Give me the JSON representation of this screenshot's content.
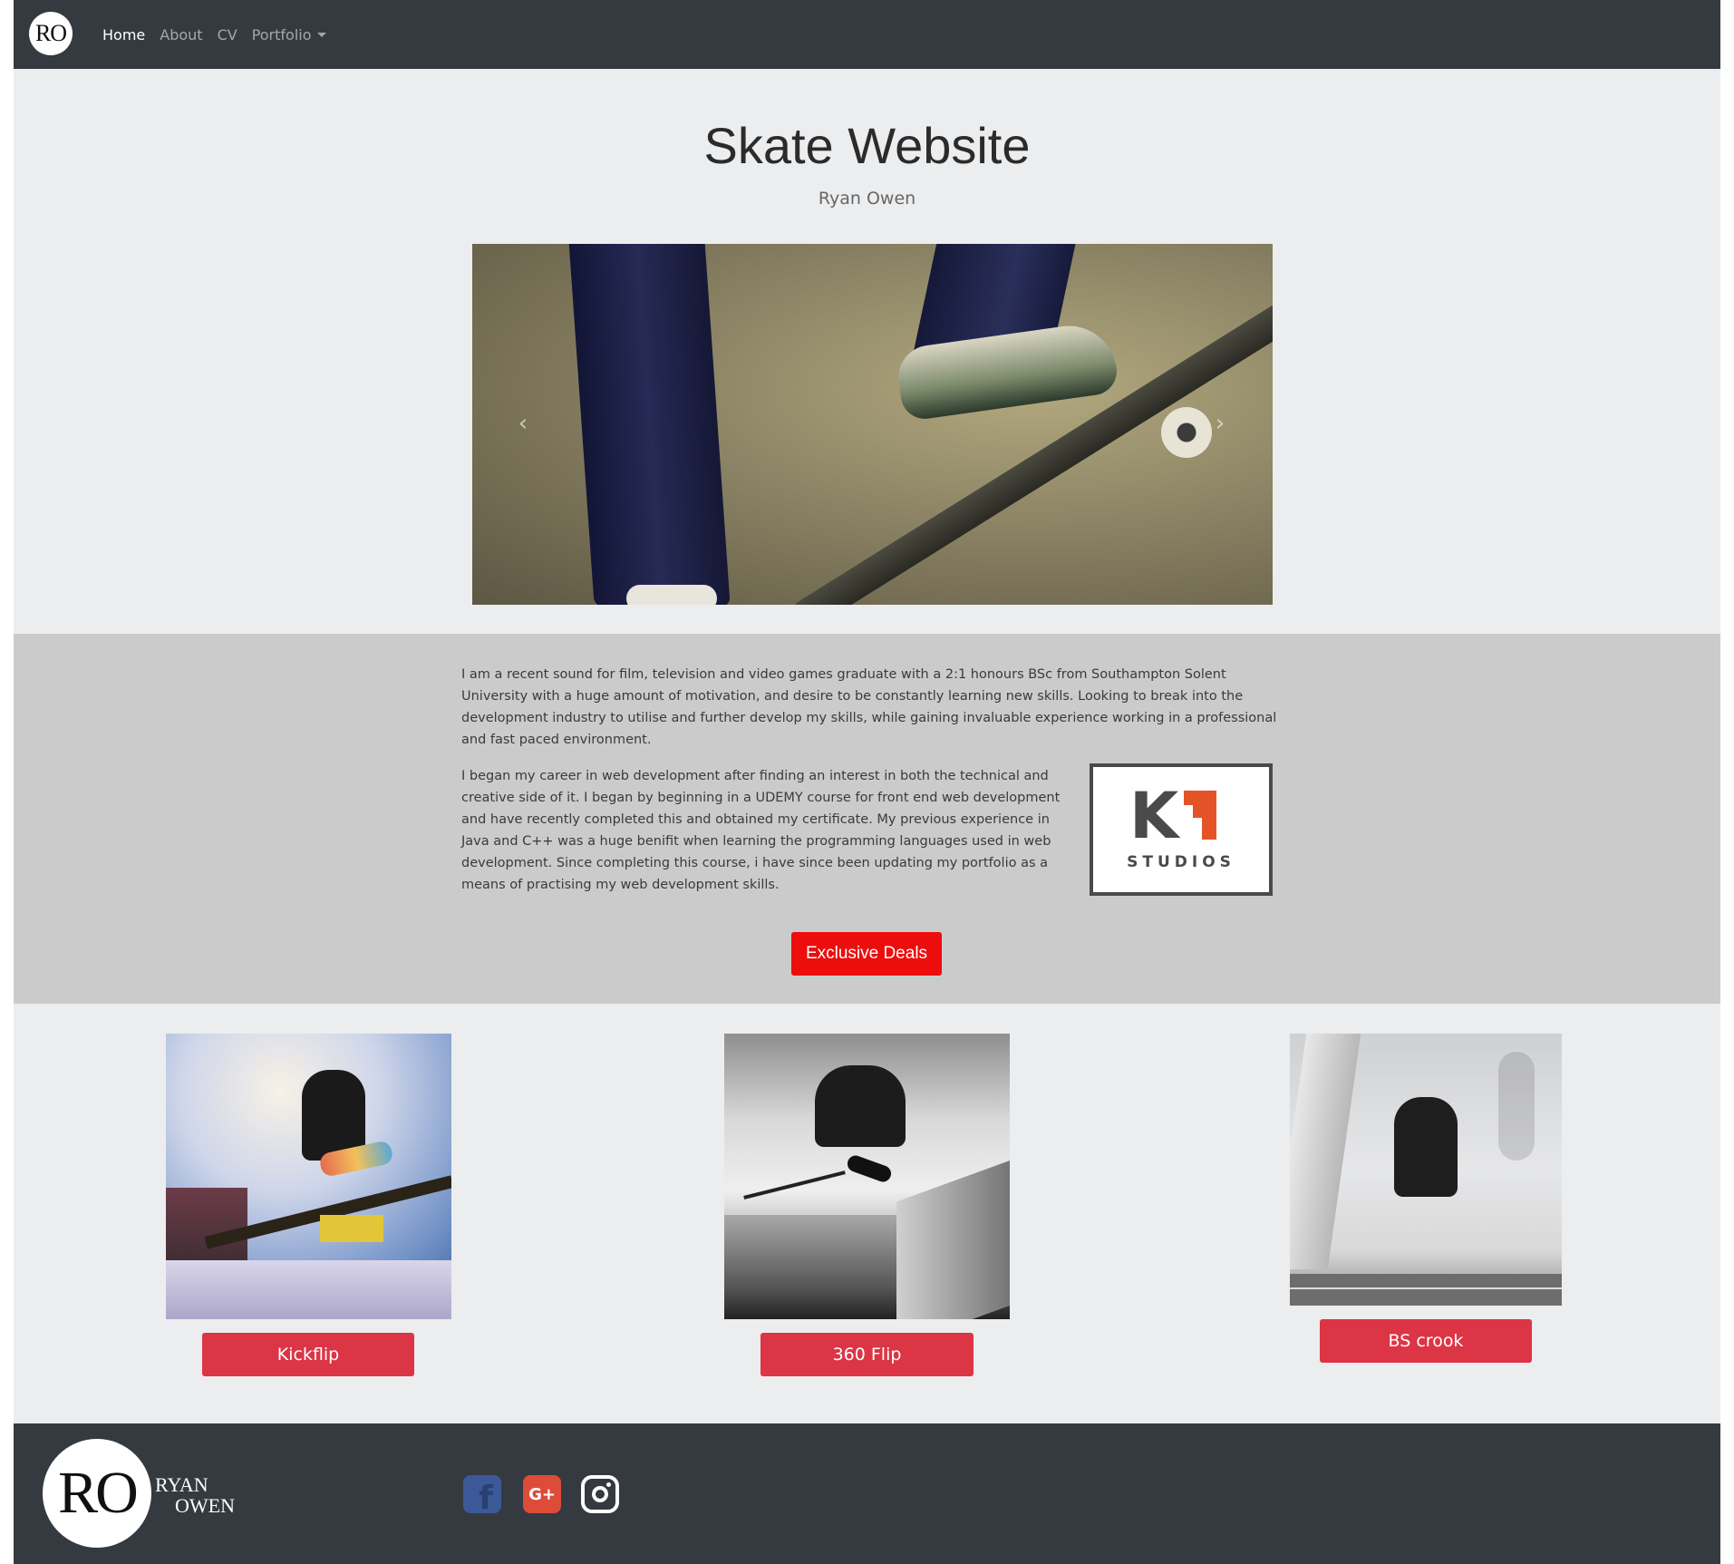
{
  "navbar": {
    "logo_text": "RO",
    "links": [
      {
        "label": "Home",
        "active": true
      },
      {
        "label": "About",
        "active": false
      },
      {
        "label": "CV",
        "active": false
      },
      {
        "label": "Portfolio",
        "active": false,
        "dropdown": true
      }
    ]
  },
  "hero": {
    "title": "Skate Website",
    "subtitle": "Ryan Owen",
    "carousel": {
      "prev_icon": "chevron-left-icon",
      "next_icon": "chevron-right-icon"
    }
  },
  "about": {
    "paragraph1": "I am a recent sound for film, television and video games graduate with a 2:1 honours BSc from Southampton Solent University with a huge amount of motivation, and desire to be constantly learning new skills. Looking to break into the development industry to utilise and further develop my skills, while gaining invaluable experience working in a professional and fast paced environment.",
    "paragraph2": "I began my career in web development after finding an interest in both the technical and creative side of it. I began by beginning in a UDEMY course for front end web development and have recently completed this and obtained my certificate. My previous experience in Java and C++ was a huge benifit when learning the programming languages used in web development. Since completing this course, i have since been updating my portfolio as a means of practising my web development skills.",
    "logo": {
      "k": "K",
      "word": "STUDIOS"
    },
    "deals_button": "Exclusive Deals",
    "deals_color": "#ee0d0d"
  },
  "tricks": [
    {
      "label": "Kickflip"
    },
    {
      "label": "360 Flip"
    },
    {
      "label": "BS crook"
    }
  ],
  "colors": {
    "navbar_bg": "#343a40",
    "button_red": "#dc3545",
    "facebook": "#3b5998",
    "google_plus": "#dd4b39"
  },
  "footer": {
    "logo_text": "RO",
    "name_line1": "RYAN",
    "name_line2": "OWEN",
    "social": [
      {
        "icon": "facebook-icon"
      },
      {
        "icon": "google-plus-icon",
        "label": "G+"
      },
      {
        "icon": "instagram-icon"
      }
    ]
  }
}
